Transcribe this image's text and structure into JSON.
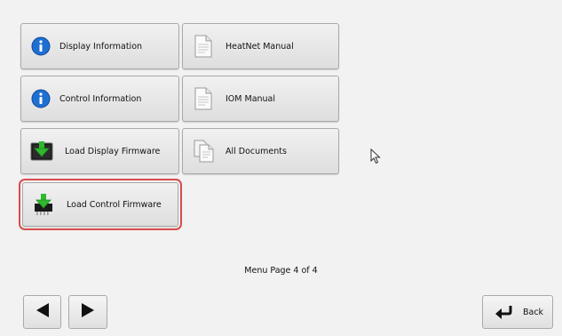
{
  "menu": {
    "items": [
      {
        "label": "Display Information",
        "icon": "info-icon"
      },
      {
        "label": "HeatNet Manual",
        "icon": "document-icon"
      },
      {
        "label": "Control Information",
        "icon": "info-icon"
      },
      {
        "label": "IOM Manual",
        "icon": "document-icon"
      },
      {
        "label": "Load Display Firmware",
        "icon": "display-firmware-download-icon"
      },
      {
        "label": "All Documents",
        "icon": "documents-stack-icon"
      },
      {
        "label": "Load Control Firmware",
        "icon": "chip-firmware-download-icon"
      }
    ],
    "selected": "Load Control Firmware"
  },
  "footer": {
    "page_label": "Menu Page 4 of 4",
    "back_label": "Back"
  },
  "colors": {
    "info_blue": "#1f6fd1",
    "download_green": "#2fb82f",
    "selection_red": "#d84b4b"
  }
}
